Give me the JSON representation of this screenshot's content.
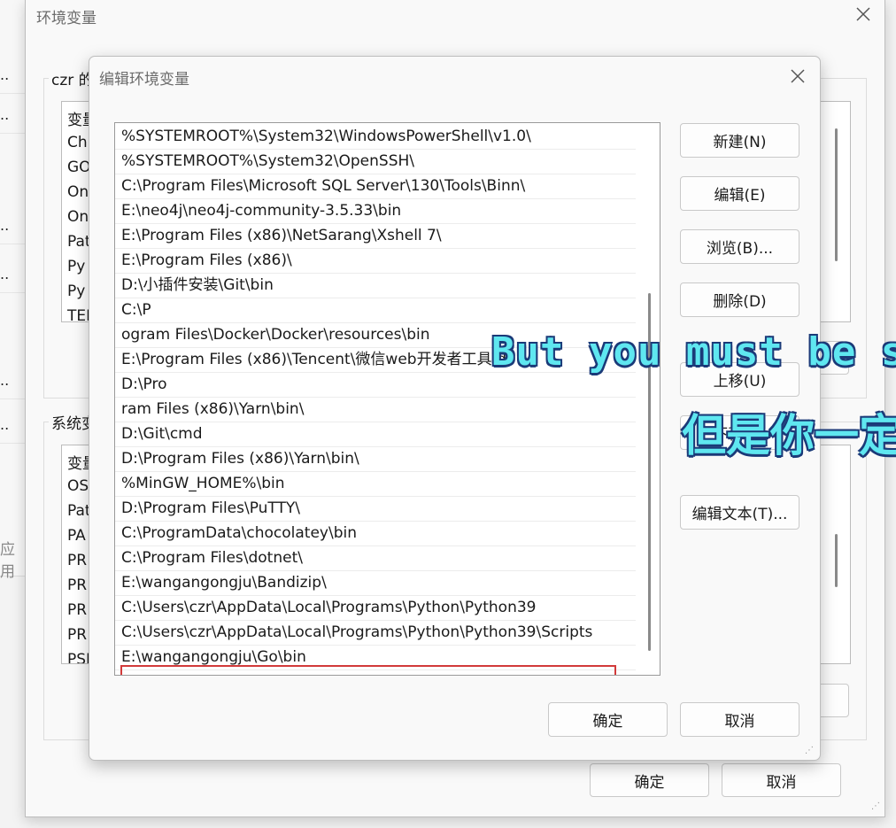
{
  "left_window": {
    "items": [
      "..",
      "..",
      "..",
      "..",
      "..",
      ".."
    ],
    "apply_label": "应用"
  },
  "outer_dialog": {
    "title": "环境变量",
    "user_group_label": "czr 的",
    "user_vars_header": "变量",
    "user_vars": [
      "Ch",
      "GO",
      "On",
      "On",
      "Pat",
      "Py",
      "Py",
      "TEI"
    ],
    "system_group_label": "系统变",
    "system_vars_header": "变量",
    "system_vars": [
      "OS",
      "Pat",
      "PA",
      "PR",
      "PR",
      "PR",
      "PR",
      "PSI"
    ],
    "ok_label": "确定",
    "cancel_label": "取消"
  },
  "edit_dialog": {
    "title": "编辑环境变量",
    "paths": [
      "%SYSTEMROOT%\\System32\\WindowsPowerShell\\v1.0\\",
      "%SYSTEMROOT%\\System32\\OpenSSH\\",
      "C:\\Program Files\\Microsoft SQL Server\\130\\Tools\\Binn\\",
      "E:\\neo4j\\neo4j-community-3.5.33\\bin",
      "E:\\Program Files (x86)\\NetSarang\\Xshell 7\\",
      "E:\\Program Files (x86)\\",
      "D:\\小插件安装\\Git\\bin",
      "C:\\P",
      "ogram Files\\Docker\\Docker\\resources\\bin",
      "E:\\Program Files (x86)\\Tencent\\微信web开发者工具\\dll",
      "D:\\Pro",
      "ram Files (x86)\\Yarn\\bin\\",
      "D:\\Git\\cmd",
      "D:\\Program Files (x86)\\Yarn\\bin\\",
      "%MinGW_HOME%\\bin",
      "D:\\Program Files\\PuTTY\\",
      "C:\\ProgramData\\chocolatey\\bin",
      "C:\\Program Files\\dotnet\\",
      "E:\\wangangongju\\Bandizip\\",
      "C:\\Users\\czr\\AppData\\Local\\Programs\\Python\\Python39",
      "C:\\Users\\czr\\AppData\\Local\\Programs\\Python\\Python39\\Scripts",
      "E:\\wangangongju\\Go\\bin"
    ],
    "buttons": {
      "new": "新建(N)",
      "edit": "编辑(E)",
      "browse": "浏览(B)...",
      "delete": "删除(D)",
      "move_up": "上移(U)",
      "move_down": "下移(O)",
      "edit_text": "编辑文本(T)...",
      "ok": "确定",
      "cancel": "取消"
    }
  },
  "subtitles": {
    "english": "But you must be so",
    "chinese": "但是你一定"
  },
  "colors": {
    "highlight_border": "#d23a3a",
    "subtitle_fill": "#5fe7f0",
    "subtitle_outline": "#1b3a78"
  }
}
